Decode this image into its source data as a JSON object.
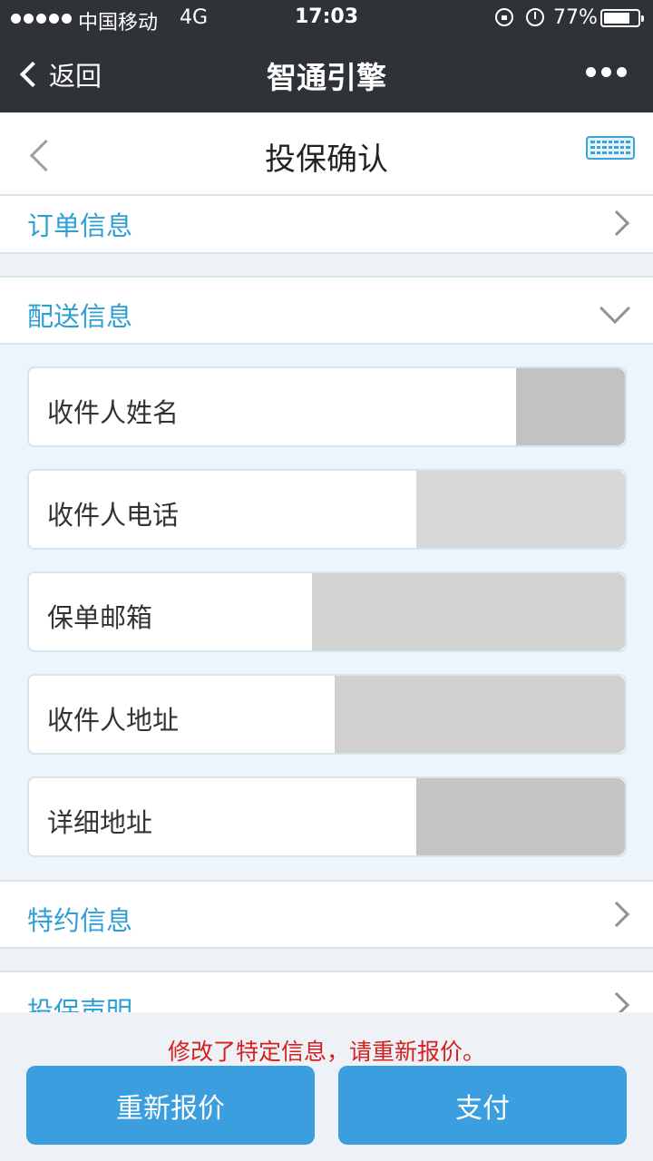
{
  "status_bar": {
    "carrier": "中国移动",
    "network": "4G",
    "time": "17:03",
    "battery_percent": "77%",
    "battery_level": 0.77,
    "icons": [
      "signal-dots-icon",
      "rotation-lock-icon",
      "alarm-icon",
      "battery-icon"
    ]
  },
  "nav_bar": {
    "back_label": "返回",
    "title": "智通引擎",
    "more_icon": "more-dots-icon"
  },
  "page": {
    "title": "投保确认",
    "back_icon": "chevron-left-icon",
    "keyboard_icon": "keyboard-icon"
  },
  "sections": {
    "order_info": {
      "label": "订单信息",
      "state": "collapsed"
    },
    "delivery_info": {
      "label": "配送信息",
      "state": "expanded",
      "fields": [
        {
          "label": "收件人姓名",
          "value": ""
        },
        {
          "label": "收件人电话",
          "value": ""
        },
        {
          "label": "保单邮箱",
          "value": ""
        },
        {
          "label": "收件人地址",
          "value": ""
        },
        {
          "label": "详细地址",
          "value": ""
        }
      ]
    },
    "special_info": {
      "label": "特约信息",
      "state": "collapsed"
    },
    "declaration": {
      "label": "投保声明",
      "state": "collapsed"
    }
  },
  "footer": {
    "notice": "修改了特定信息，请重新报价。",
    "requote_button": "重新报价",
    "pay_button": "支付"
  },
  "colors": {
    "accent": "#2e9fd4",
    "button": "#3a9edf",
    "notice": "#d42020",
    "bar": "#2f3237"
  }
}
